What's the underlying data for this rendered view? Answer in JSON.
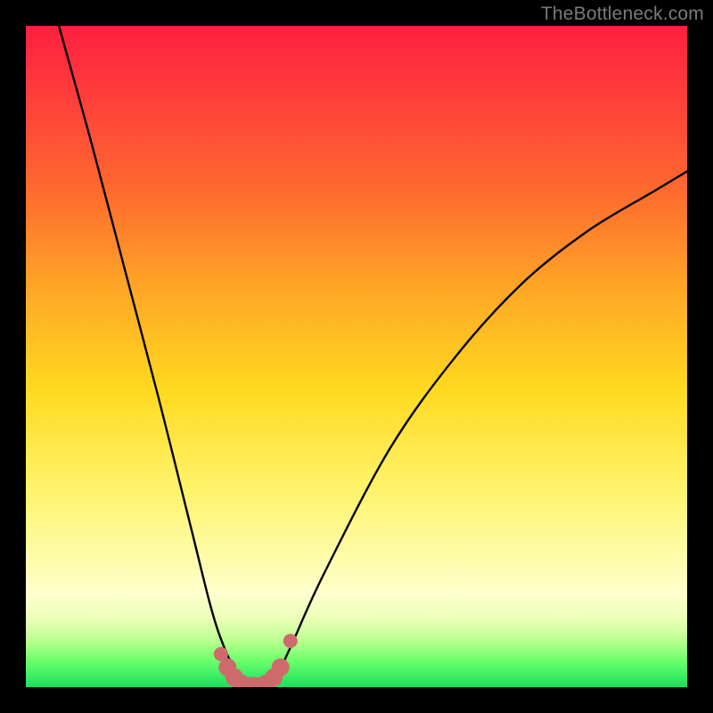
{
  "watermark": "TheBottleneck.com",
  "chart_data": {
    "type": "line",
    "title": "",
    "xlabel": "",
    "ylabel": "",
    "xlim": [
      0,
      100
    ],
    "ylim": [
      0,
      100
    ],
    "note": "Axes are unlabeled in the image; values below are estimated from pixel position as percentage of the plot area (x left→right, y bottom→top).",
    "series": [
      {
        "name": "bottleneck-curve",
        "x": [
          5,
          10,
          15,
          20,
          25,
          28,
          30,
          32,
          34,
          35,
          36,
          38,
          40,
          45,
          55,
          65,
          75,
          85,
          95,
          100
        ],
        "y": [
          100,
          82,
          63,
          44,
          24,
          12,
          6,
          2,
          0,
          0,
          0,
          2,
          6,
          17,
          36,
          50,
          61,
          69,
          75,
          78
        ]
      }
    ],
    "markers": {
      "name": "highlighted-points",
      "color": "#cf6a6c",
      "x": [
        29.5,
        30.5,
        31.5,
        32.5,
        33.5,
        34.5,
        35.5,
        36.5,
        37.5,
        38.5,
        40.0
      ],
      "y": [
        5.0,
        3.0,
        1.5,
        0.6,
        0.2,
        0.2,
        0.2,
        0.6,
        1.5,
        3.0,
        7.0
      ]
    },
    "background": {
      "type": "vertical-gradient",
      "stops": [
        {
          "pos": 0.0,
          "color": "#ff1f3f"
        },
        {
          "pos": 0.55,
          "color": "#ffd91f"
        },
        {
          "pos": 0.86,
          "color": "#feffce"
        },
        {
          "pos": 1.0,
          "color": "#18e05f"
        }
      ]
    }
  }
}
